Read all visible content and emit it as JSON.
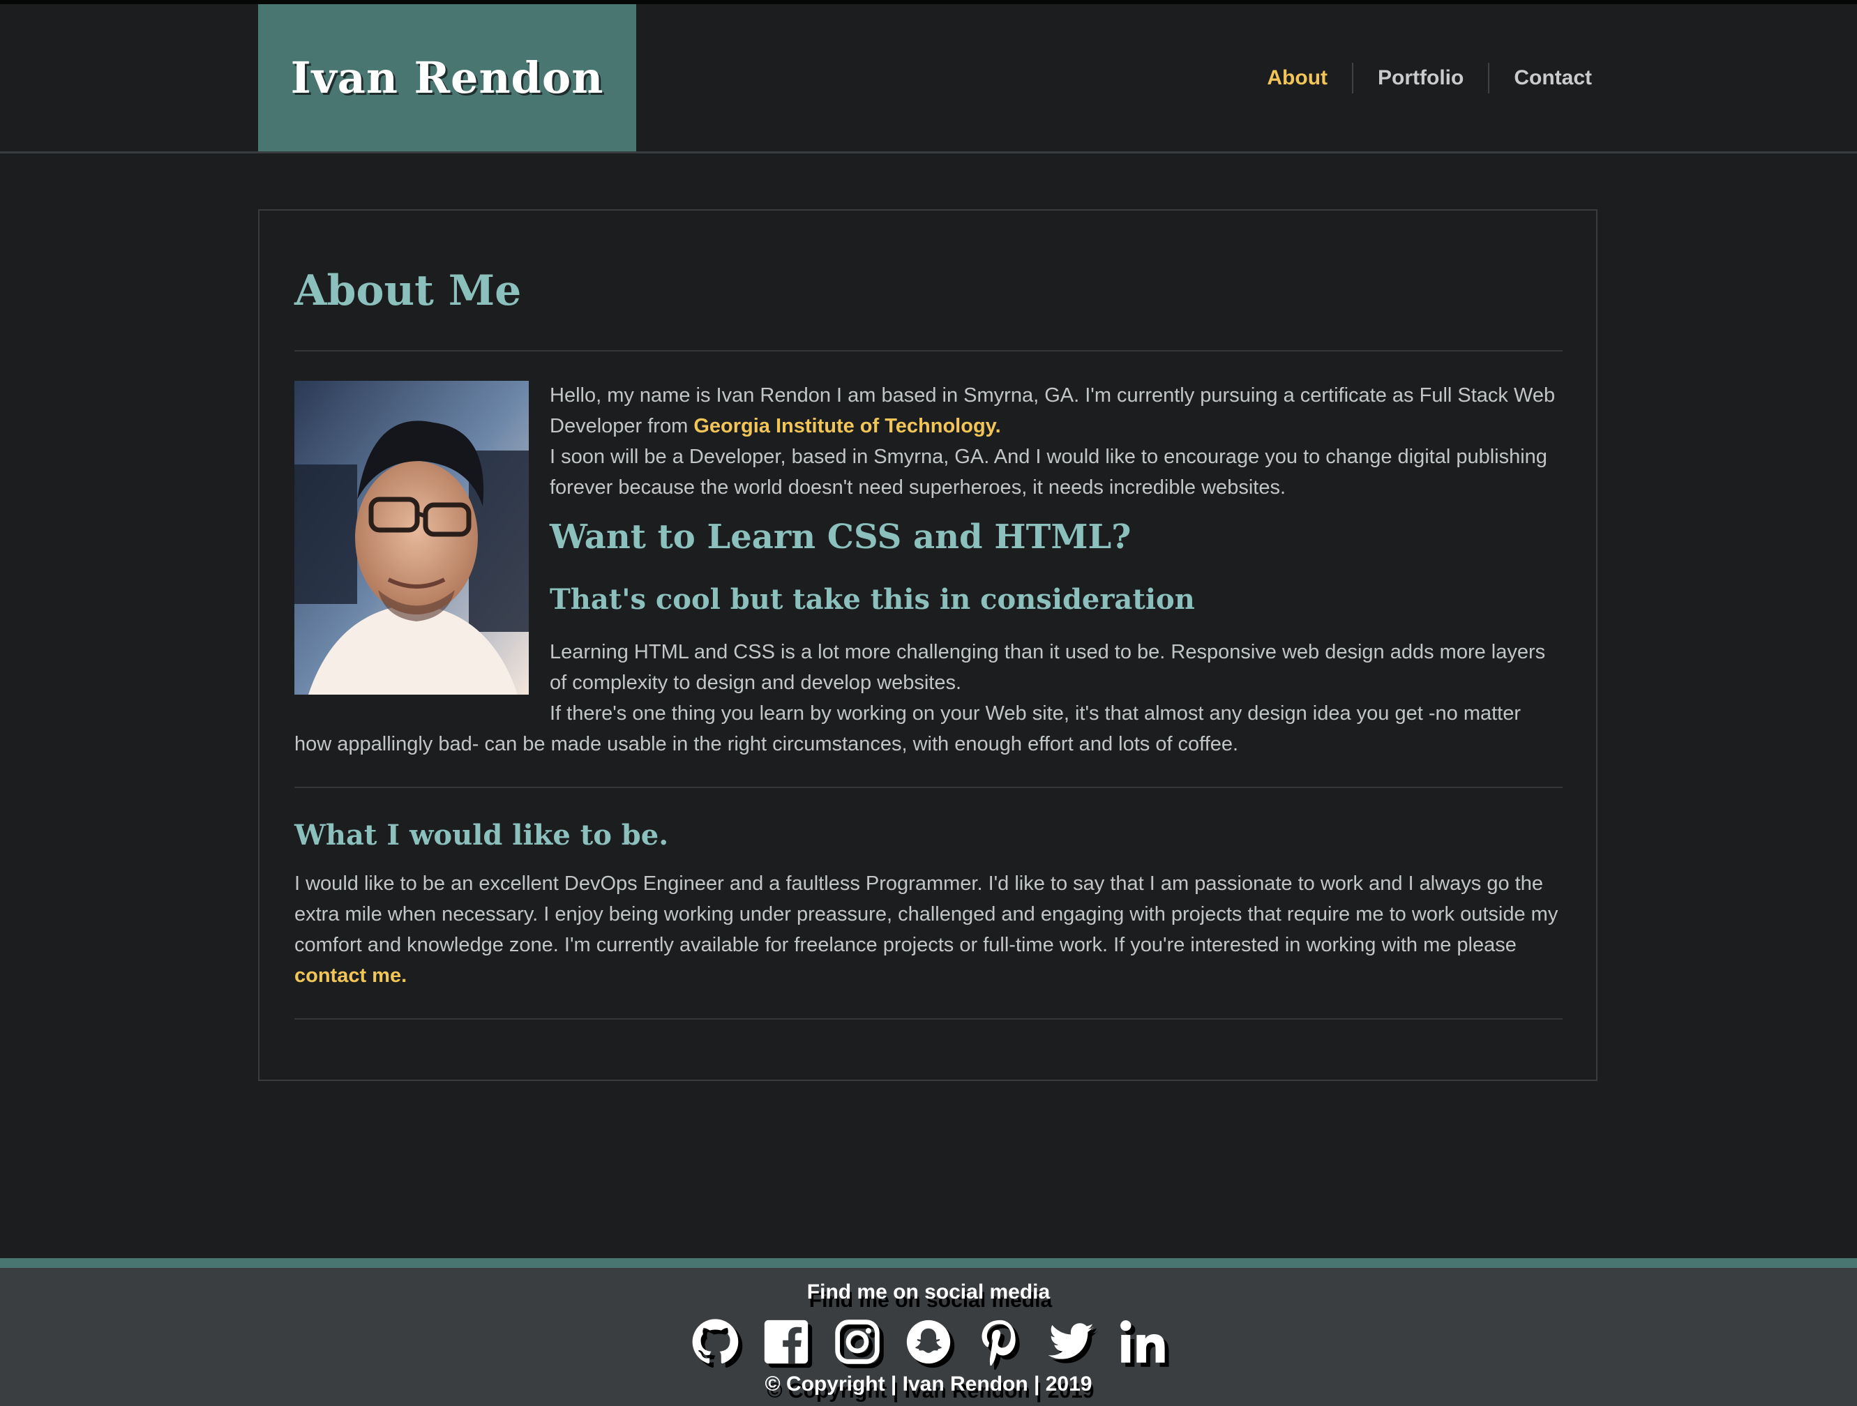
{
  "header": {
    "brand": "Ivan Rendon",
    "nav": [
      {
        "label": "About",
        "active": true
      },
      {
        "label": "Portfolio",
        "active": false
      },
      {
        "label": "Contact",
        "active": false
      }
    ]
  },
  "about": {
    "title": "About Me",
    "intro_1": "Hello, my name is Ivan Rendon I am based in Smyrna, GA. I'm currently pursuing a certificate as Full Stack Web Developer from ",
    "intro_link": "Georgia Institute of Technology.",
    "intro_2": "I soon will be a Developer, based in Smyrna, GA. And I would like to encourage you to change digital publishing forever because the world doesn't need superheroes, it needs incredible websites.",
    "learn_heading": "Want to Learn CSS and HTML?",
    "learn_subheading": "That's cool but take this in consideration",
    "learn_1": "Learning HTML and CSS is a lot more challenging than it used to be. Responsive web design adds more layers of complexity to design and develop websites.",
    "learn_2": "If there's one thing you learn by working on your Web site, it's that almost any design idea you get -no matter how appallingly bad- can be made usable in the right circumstances, with enough effort and lots of coffee.",
    "bio_heading": "What I would like to be.",
    "bio_text": "I would like to be an excellent DevOps Engineer and a faultless Programmer. I'd like to say that I am passionate to work and I always go the extra mile when necessary. I enjoy being working under preassure, challenged and engaging with projects that require me to work outside my comfort and knowledge zone. I'm currently available for freelance projects or full-time work. If you're interested in working with me please ",
    "bio_link": "contact me."
  },
  "footer": {
    "social_title": "Find me on social media",
    "icons": [
      "github-icon",
      "facebook-icon",
      "instagram-icon",
      "snapchat-icon",
      "pinterest-icon",
      "twitter-icon",
      "linkedin-icon"
    ],
    "copyright": "© Copyright | Ivan Rendon | 2019"
  },
  "colors": {
    "accent": "#4a7672",
    "heading": "#8cc0bc",
    "link": "#f1c557",
    "background": "#1b1d1f",
    "footer": "#3a3e41"
  }
}
